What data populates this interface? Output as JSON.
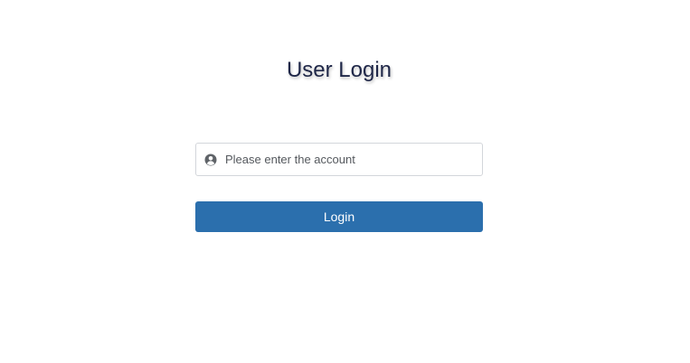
{
  "login": {
    "title": "User Login",
    "account_placeholder": "Please enter the account",
    "account_value": "",
    "submit_label": "Login",
    "user_icon": "user-circle-icon"
  },
  "colors": {
    "title": "#1f2748",
    "button_bg": "#2b6fad",
    "button_text": "#ffffff",
    "input_border": "#d3d6db"
  }
}
